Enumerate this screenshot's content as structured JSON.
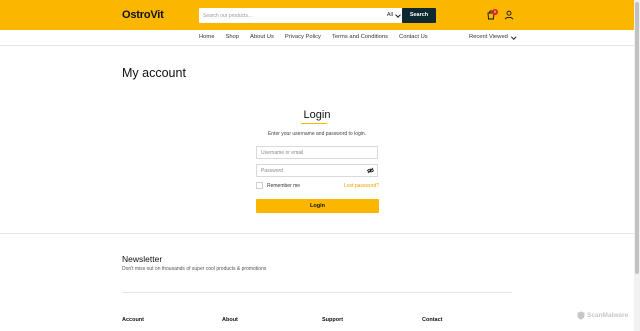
{
  "header": {
    "logo": "OstroVit",
    "search": {
      "placeholder": "Search our products...",
      "category": "All",
      "button": "Search"
    },
    "cart_count": "0",
    "colors": {
      "accent": "#fbb600",
      "dark": "#0d2a33",
      "badge": "#e02424"
    },
    "icons": [
      "cart-icon",
      "user-icon",
      "chevron-down-icon"
    ]
  },
  "nav": {
    "links": [
      "Home",
      "Shop",
      "About Us",
      "Privacy Policy",
      "Terms and Conditions",
      "Contact Us"
    ],
    "recent": "Recent Viewed"
  },
  "page": {
    "title": "My account"
  },
  "login": {
    "title": "Login",
    "subtitle": "Enter your username and password to login.",
    "username_placeholder": "Username or email",
    "password_placeholder": "Password",
    "remember": "Remember me",
    "lost": "Lost password?",
    "button": "Login"
  },
  "newsletter": {
    "title": "Newsletter",
    "subtitle": "Don't miss out on thousands of super cool products & promotions"
  },
  "footer": {
    "columns": [
      "Account",
      "About",
      "Support",
      "Contact"
    ]
  },
  "watermark": "ScanMalware"
}
